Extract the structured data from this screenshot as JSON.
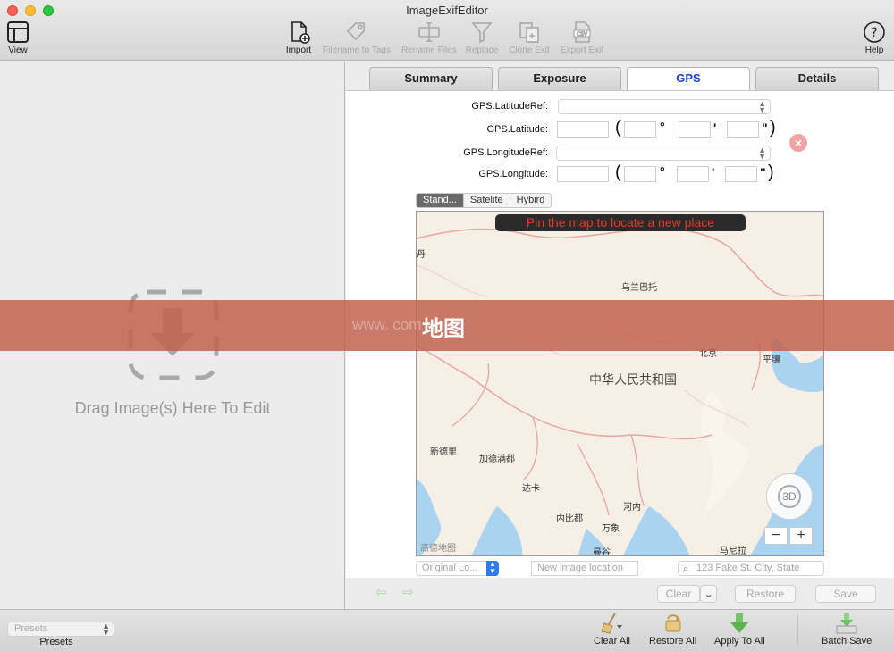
{
  "window": {
    "title": "ImageExifEditor"
  },
  "toolbar": {
    "view": "View",
    "import": "Import",
    "filename_to_tags": "Filename to Tags",
    "rename_files": "Rename Files",
    "replace": "Replace",
    "clone_exif": "Clone Exif",
    "export_exif": "Export Exif",
    "help": "Help"
  },
  "left_pane": {
    "drop_text": "Drag Image(s) Here To Edit"
  },
  "tabs": [
    {
      "label": "Summary",
      "active": false
    },
    {
      "label": "Exposure",
      "active": false
    },
    {
      "label": "GPS",
      "active": true
    },
    {
      "label": "Details",
      "active": false
    }
  ],
  "gps": {
    "latitude_ref_label": "GPS.LatitudeRef:",
    "latitude_label": "GPS.Latitude:",
    "longitude_ref_label": "GPS.LongitudeRef:",
    "longitude_label": "GPS.Longitude:",
    "open_paren": "(",
    "close_paren": ")",
    "degree": "°",
    "minute": "'",
    "second": "\""
  },
  "map_modes": [
    "Stand...",
    "Satelite",
    "Hybird"
  ],
  "map": {
    "banner": "Pin the map to locate a new place",
    "country": "中华人民共和国",
    "cities": {
      "ulaanbaatar": "乌兰巴托",
      "beijing": "北京",
      "pyongyang": "平壤",
      "new_delhi": "新德里",
      "kathmandu": "加德满都",
      "dhaka": "达卡",
      "naypyidaw": "内比都",
      "hanoi": "河内",
      "vientiane": "万象",
      "bangkok": "曼谷",
      "manila": "马尼拉",
      "edge": "丹"
    },
    "logo": "高德地图",
    "compass_label": "3D",
    "zoom_out": "−",
    "zoom_in": "+"
  },
  "location": {
    "original_select": "Original Lo...",
    "new_location_placeholder": "New image location",
    "search_placeholder": "123 Fake St. City, State"
  },
  "actions": {
    "back_arrow": "⇦",
    "forward_arrow": "⇨",
    "clear": "Clear",
    "restore": "Restore",
    "save": "Save"
  },
  "bottom": {
    "presets_select": "Presets",
    "presets_label": "Presets",
    "clear_all": "Clear All",
    "restore_all": "Restore All",
    "apply_to_all": "Apply To All",
    "batch_save": "Batch Save"
  },
  "overlay": {
    "label": "地图",
    "watermark": "www.          com"
  }
}
